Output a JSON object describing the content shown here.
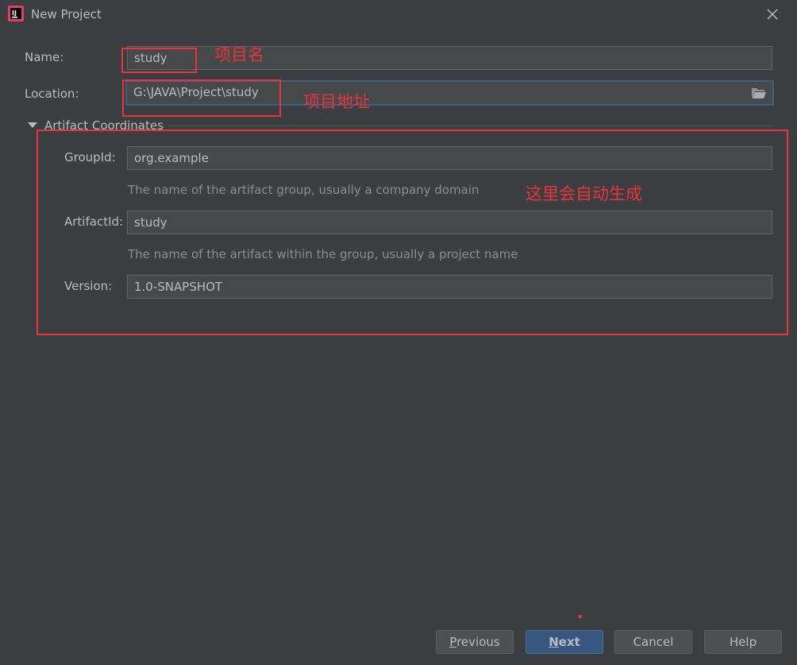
{
  "window": {
    "title": "New Project"
  },
  "form": {
    "name_label": "Name:",
    "name_value": "study",
    "location_label": "Location:",
    "location_value": "G:\\JAVA\\Project\\study",
    "section_title": "Artifact Coordinates",
    "groupid_label": "GroupId:",
    "groupid_value": "org.example",
    "groupid_hint": "The name of the artifact group, usually a company domain",
    "artifactid_label": "ArtifactId:",
    "artifactid_value": "study",
    "artifactid_hint": "The name of the artifact within the group, usually a project name",
    "version_label": "Version:",
    "version_value": "1.0-SNAPSHOT"
  },
  "annotations": {
    "name_note": "项目名",
    "location_note": "项目地址",
    "auto_note": "这里会自动生成"
  },
  "buttons": {
    "previous_mnemonic": "P",
    "previous_rest": "revious",
    "next_mnemonic": "N",
    "next_rest": "ext",
    "cancel": "Cancel",
    "help": "Help"
  },
  "colors": {
    "background": "#3c3f41",
    "field_bg": "#45494a",
    "accent_blue": "#365880",
    "annotation_red": "#e8343a"
  },
  "icons": {
    "app": "intellij-idea-icon",
    "close": "close-icon",
    "folder": "folder-open-icon",
    "collapse": "triangle-down-icon"
  }
}
